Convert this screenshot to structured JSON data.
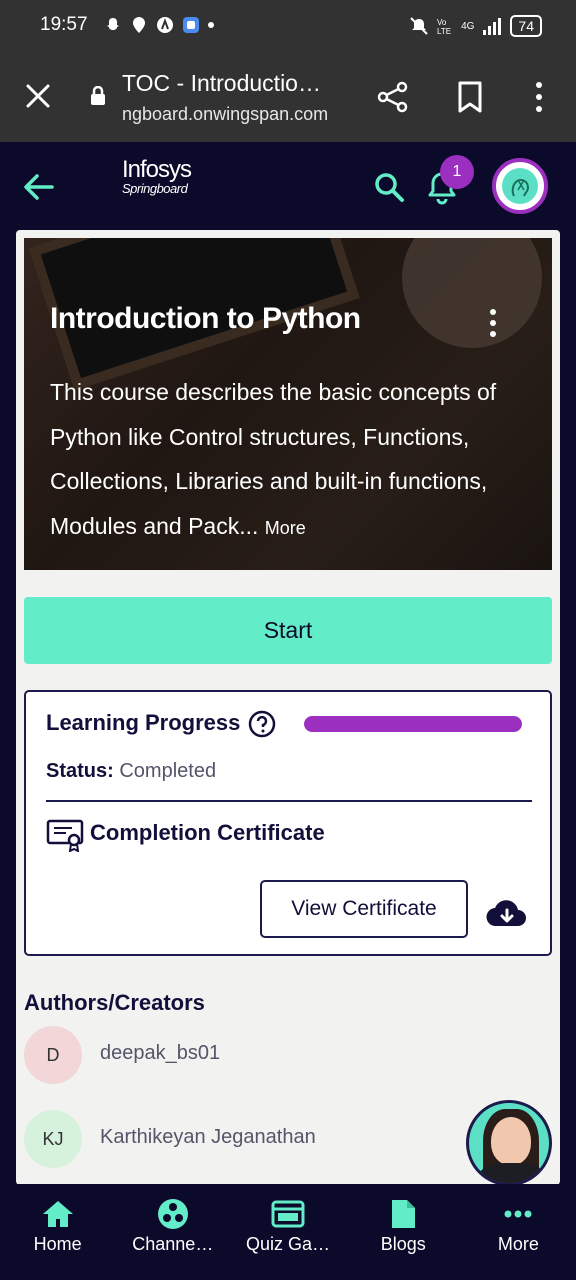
{
  "status_bar": {
    "time": "19:57",
    "battery": "74",
    "net_label": "4G"
  },
  "browser": {
    "tab_title": "TOC - Introductio…",
    "url": "ngboard.onwingspan.com"
  },
  "header": {
    "logo_line1": "Infosys",
    "logo_line2": "Springboard",
    "notification_count": "1"
  },
  "course": {
    "title": "Introduction to Python",
    "description": "This course describes the basic concepts of Python like Control structures, Functions, Collections, Libraries and built-in functions, Modules and Pack...",
    "more_label": "More",
    "start_label": "Start"
  },
  "progress": {
    "label": "Learning Progress",
    "percent": 100,
    "status_label": "Status:",
    "status_value": "Completed",
    "certificate_title": "Completion Certificate",
    "view_certificate_label": "View Certificate"
  },
  "authors": {
    "title": "Authors/Creators",
    "items": [
      {
        "initials": "D",
        "name": "deepak_bs01",
        "color": "#f2d6d8"
      },
      {
        "initials": "KJ",
        "name": "Karthikeyan Jeganathan",
        "color": "#d6f2dc"
      }
    ]
  },
  "bottom_nav": {
    "items": [
      {
        "label": "Home",
        "icon": "home-icon"
      },
      {
        "label": "Channe…",
        "icon": "channels-icon"
      },
      {
        "label": "Quiz Ga…",
        "icon": "quiz-icon"
      },
      {
        "label": "Blogs",
        "icon": "blog-icon"
      },
      {
        "label": "More",
        "icon": "more-dots-icon"
      }
    ]
  },
  "colors": {
    "accent": "#62ecc7",
    "purple": "#9b2fbf",
    "navy": "#0c0a2a"
  }
}
